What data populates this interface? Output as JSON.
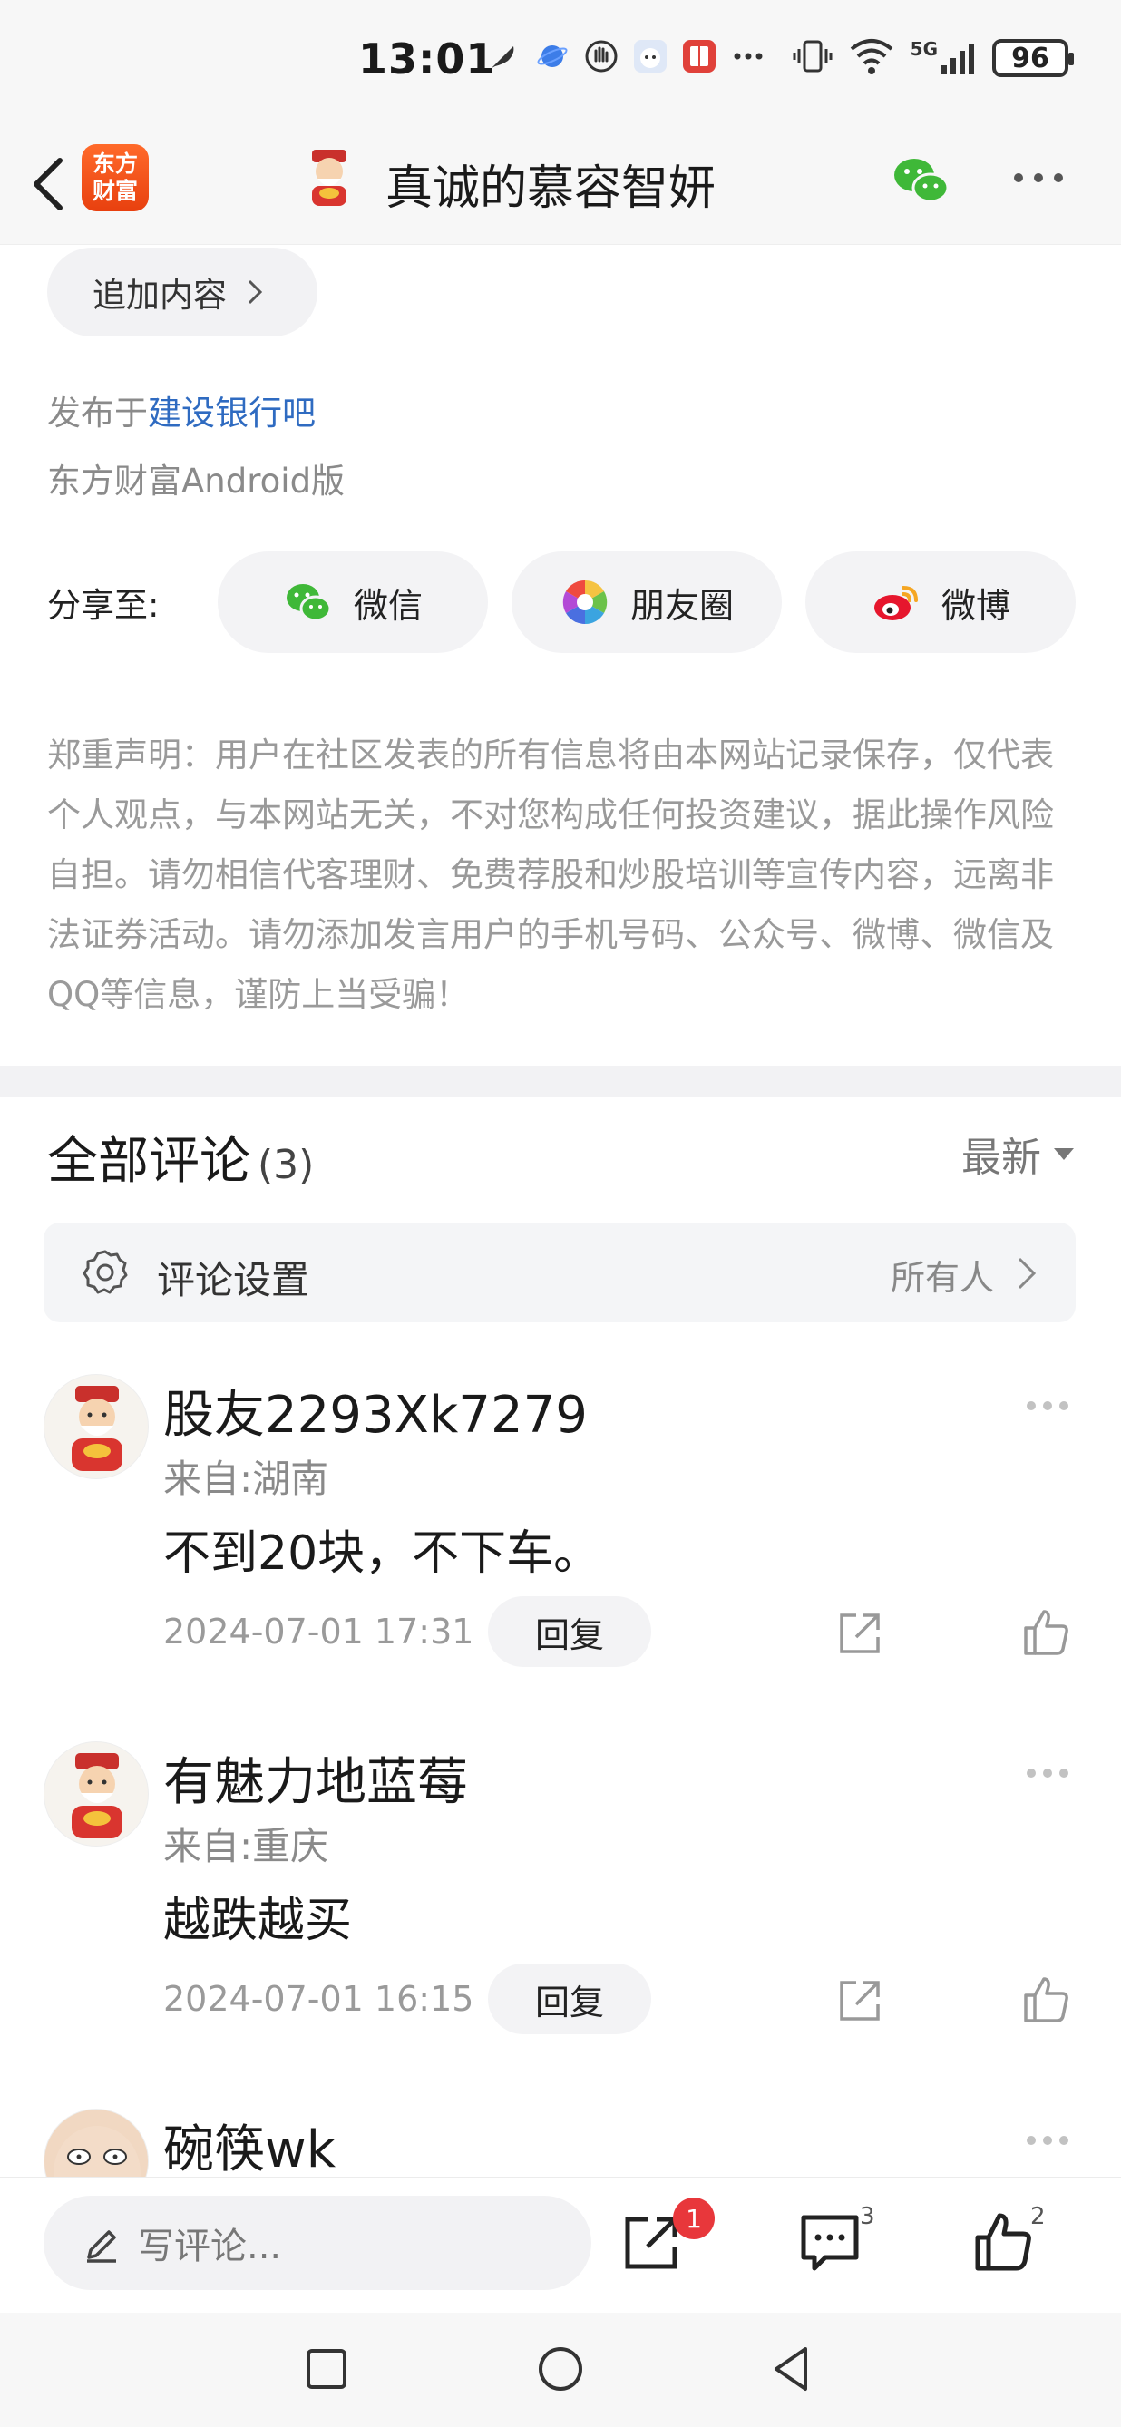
{
  "status_bar": {
    "time": "13:01",
    "battery": "96",
    "network": "5G"
  },
  "header": {
    "logo_line1": "东方",
    "logo_line2": "财富",
    "title": "真诚的慕容智妍"
  },
  "post": {
    "add_content_label": "追加内容",
    "published_prefix": "发布于",
    "published_forum": "建设银行吧",
    "platform": "东方财富Android版"
  },
  "share": {
    "label": "分享至:",
    "wechat": "微信",
    "moments": "朋友圈",
    "weibo": "微博"
  },
  "disclaimer": "郑重声明：用户在社区发表的所有信息将由本网站记录保存，仅代表个人观点，与本网站无关，不对您构成任何投资建议，据此操作风险自担。请勿相信代客理财、免费荐股和炒股培训等宣传内容，远离非法证券活动。请勿添加发言用户的手机号码、公众号、微博、微信及QQ等信息，谨防上当受骗！",
  "comments_section": {
    "title": "全部评论",
    "count": "(3)",
    "sort": "最新",
    "settings_label": "评论设置",
    "settings_value": "所有人"
  },
  "comments": [
    {
      "name": "股友2293Xk7279",
      "location": "来自:湖南",
      "text": "不到20块，不下车。",
      "time": "2024-07-01 17:31",
      "reply": "回复"
    },
    {
      "name": "有魅力地蓝莓",
      "location": "来自:重庆",
      "text": "越跌越买",
      "time": "2024-07-01 16:15",
      "reply": "回复"
    },
    {
      "name": "碗筷wk"
    }
  ],
  "bottom_bar": {
    "write_placeholder": "写评论...",
    "share_badge": "1",
    "comment_count": "3",
    "like_count": "2"
  },
  "colors": {
    "accent_link": "#2f6bc1",
    "brand_orange": "#e8400f",
    "badge_red": "#e8373b",
    "wechat_green": "#3fb838"
  }
}
